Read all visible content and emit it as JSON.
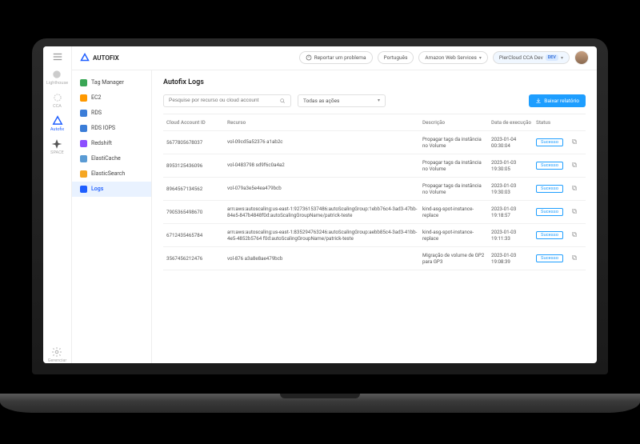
{
  "brand": {
    "name": "AUTOFIX"
  },
  "topbar": {
    "report": "Reportar um problema",
    "language": "Português",
    "cloud": "Amazon Web Services",
    "account": "PierCloud CCA Dev",
    "badge": "DEV"
  },
  "rail": {
    "items": [
      {
        "label": "Lighthouse",
        "active": false
      },
      {
        "label": "CCA",
        "active": false
      },
      {
        "label": "Autofix",
        "active": true
      },
      {
        "label": "SPACE",
        "active": false
      }
    ],
    "manage": "Gerenciar"
  },
  "sidebar": {
    "items": [
      {
        "label": "Tag Manager"
      },
      {
        "label": "EC2"
      },
      {
        "label": "RDS"
      },
      {
        "label": "RDS IOPS"
      },
      {
        "label": "Redshift"
      },
      {
        "label": "ElastiCache"
      },
      {
        "label": "ElasticSearch"
      },
      {
        "label": "Logs"
      }
    ]
  },
  "page": {
    "title": "Autofix Logs",
    "search_placeholder": "Pesquise por recurso ou cloud account",
    "filter": "Todas as ações",
    "download": "Baixar relatório"
  },
  "table": {
    "headers": {
      "account": "Cloud Account ID",
      "resource": "Recurso",
      "description": "Descrição",
      "date": "Data de execução",
      "status": "Status"
    },
    "rows": [
      {
        "account": "567780567803​7",
        "resource": "vol-09cd5a52376 a1ab2c",
        "description": "Propagar tags da instância no Volume",
        "date": "2023-01-04 00:30:04",
        "status": "Sucesso"
      },
      {
        "account": "895312543609​6",
        "resource": "vol-0483798 sd9f6c0a4a2",
        "description": "Propagar tags da instância no Volume",
        "date": "2023-01-03 19:30:05",
        "status": "Sucesso"
      },
      {
        "account": "896456713456​2",
        "resource": "vol-079a3e5e4ea479bcb",
        "description": "Propagar tags da instância no Volume",
        "date": "2023-01-03 19:30:03",
        "status": "Sucesso"
      },
      {
        "account": "790536549867​0",
        "resource": "arn:aws:autoscaling:us-east-1:927361537486:autoScalingGroup:1ebb76c4-3ad3-47bb-84e5-847b4848f0d:autoScalingGroupName/patrick-teste",
        "description": "kind-asg-spot-instance-replace",
        "date": "2023-01-03 19:18:57",
        "status": "Sucesso"
      },
      {
        "account": "671243546578​4",
        "resource": "arn:aws:autoscaling:us-east-1:835294763246:autoScalingGroup:aebb85c4-3ad3-41bb-4e5-4852b5764 f0d:autoScalingGroupName/patrick-teste",
        "description": "kind-asg-spot-instance-replace",
        "date": "2023-01-03 19:11:33",
        "status": "Sucesso"
      },
      {
        "account": "356745621247​6",
        "resource": "vol-876 a3a8e8ae479bcb",
        "description": "Migração de volume de GP2 para GP3",
        "date": "2023-01-03 19:08:39",
        "status": "Sucesso"
      }
    ]
  }
}
